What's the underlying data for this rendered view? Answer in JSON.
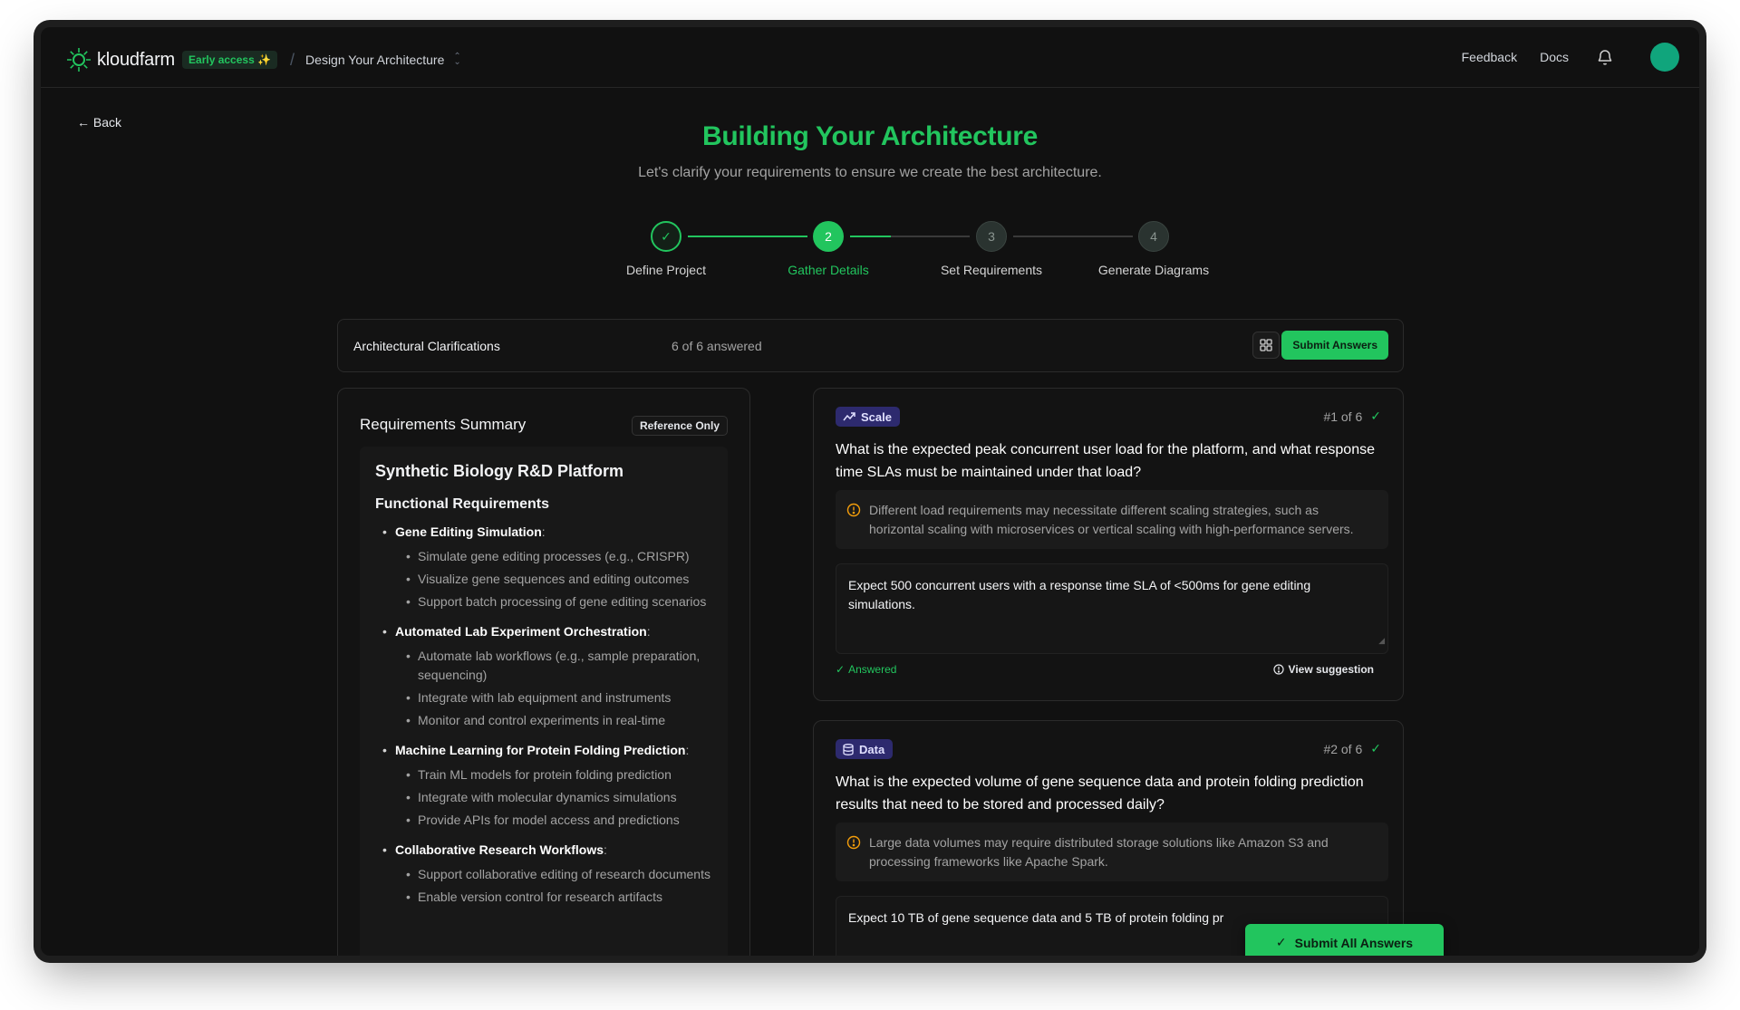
{
  "brand": {
    "name": "kloudfarm",
    "badge": "Early access ✨"
  },
  "header": {
    "project": "Design Your Architecture",
    "nav": [
      "Feedback",
      "Docs"
    ]
  },
  "back_label": "← Back",
  "hero": {
    "title": "Building Your Architecture",
    "subtitle": "Let's clarify your requirements to ensure we create the best architecture."
  },
  "steps": [
    {
      "num": "✓",
      "label": "Define Project",
      "state": "done"
    },
    {
      "num": "2",
      "label": "Gather Details",
      "state": "active"
    },
    {
      "num": "3",
      "label": "Set Requirements",
      "state": "todo"
    },
    {
      "num": "4",
      "label": "Generate Diagrams",
      "state": "todo"
    }
  ],
  "clarifications": {
    "title": "Architectural Clarifications",
    "count": "6 of 6 answered",
    "submit_label": "Submit Answers"
  },
  "summary": {
    "title": "Requirements Summary",
    "badge": "Reference Only",
    "project_name": "Synthetic Biology R&D Platform",
    "section": "Functional Requirements",
    "features": [
      {
        "title": "Gene Editing Simulation",
        "items": [
          "Simulate gene editing processes (e.g., CRISPR)",
          "Visualize gene sequences and editing outcomes",
          "Support batch processing of gene editing scenarios"
        ]
      },
      {
        "title": "Automated Lab Experiment Orchestration",
        "items": [
          "Automate lab workflows (e.g., sample preparation, sequencing)",
          "Integrate with lab equipment and instruments",
          "Monitor and control experiments in real-time"
        ]
      },
      {
        "title": "Machine Learning for Protein Folding Prediction",
        "items": [
          "Train ML models for protein folding prediction",
          "Integrate with molecular dynamics simulations",
          "Provide APIs for model access and predictions"
        ]
      },
      {
        "title": "Collaborative Research Workflows",
        "items": [
          "Support collaborative editing of research documents",
          "Enable version control for research artifacts"
        ]
      }
    ]
  },
  "questions": [
    {
      "tag": "Scale",
      "number": "#1 of 6",
      "text": "What is the expected peak concurrent user load for the platform, and what response time SLAs must be maintained under that load?",
      "hint": "Different load requirements may necessitate different scaling strategies, such as horizontal scaling with microservices or vertical scaling with high-performance servers.",
      "answer": "Expect 500 concurrent users with a response time SLA of <500ms for gene editing simulations.",
      "status": "Answered",
      "suggestion": "View suggestion"
    },
    {
      "tag": "Data",
      "number": "#2 of 6",
      "text": "What is the expected volume of gene sequence data and protein folding prediction results that need to be stored and processed daily?",
      "hint": "Large data volumes may require distributed storage solutions like Amazon S3 and processing frameworks like Apache Spark.",
      "answer": "Expect 10 TB of gene sequence data and 5 TB of protein folding pr"
    }
  ],
  "float_submit": "Submit All Answers",
  "colors": {
    "accent": "#22c55e",
    "tag_bg": "#2d2a6e",
    "avatar": "#10a57c"
  }
}
